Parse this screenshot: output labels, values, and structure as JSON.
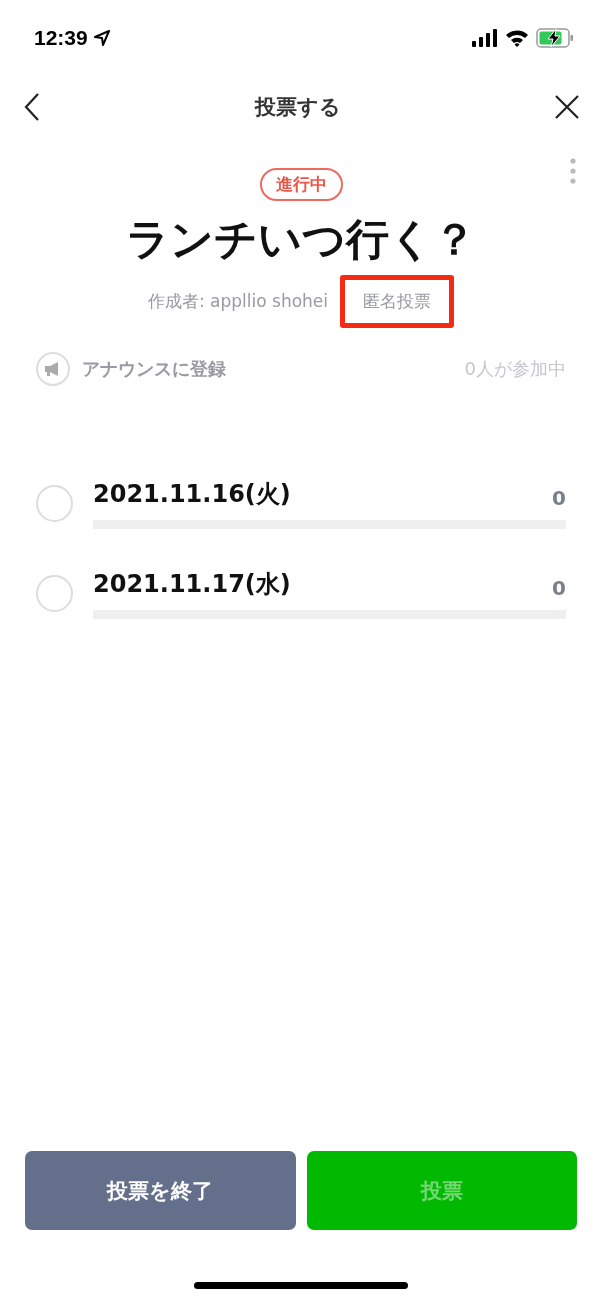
{
  "status_bar": {
    "time": "12:39"
  },
  "header": {
    "title": "投票する"
  },
  "poll": {
    "status": "進行中",
    "title": "ランチいつ行く？",
    "creator": "作成者: appllio shohei",
    "anonymous": {
      "label": "匿名投票",
      "highlighted": true
    }
  },
  "announce": {
    "label": "アナウンスに登録",
    "participants": "0人が参加中"
  },
  "options": [
    {
      "label": "2021.11.16(火)",
      "count": "0",
      "selected": false,
      "level": 0
    },
    {
      "label": "2021.11.17(水)",
      "count": "0",
      "selected": false,
      "level": 0
    }
  ],
  "buttons": [
    {
      "label": "投票を終了",
      "kind": "secondary",
      "disabled": false
    },
    {
      "label": "投票",
      "kind": "primary",
      "disabled": true
    }
  ]
}
